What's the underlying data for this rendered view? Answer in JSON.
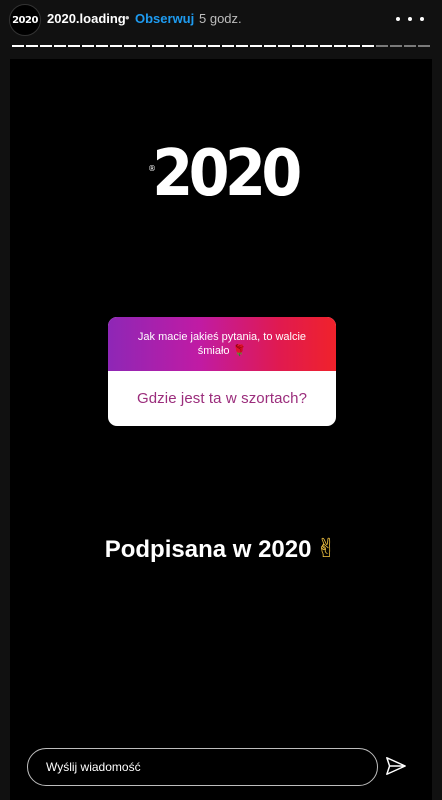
{
  "header": {
    "avatar_text": "2020",
    "username": "2020.loading",
    "separator": "•",
    "follow_label": "Obserwuj",
    "time": "5 godz.",
    "more_icon": "more-horizontal-icon"
  },
  "story": {
    "logo_text": "2020",
    "logo_mark": "®",
    "question": {
      "prompt": "Jak macie jakieś pytania, to walcie śmiało 🌹",
      "answer": "Gdzie jest ta w szortach?"
    },
    "caption": "Podpisana w 2020",
    "caption_emoji": "✌"
  },
  "footer": {
    "message_placeholder": "Wyślij wiadomość",
    "send_icon": "send-icon"
  },
  "progress": {
    "segments": 30,
    "watched": 26
  }
}
